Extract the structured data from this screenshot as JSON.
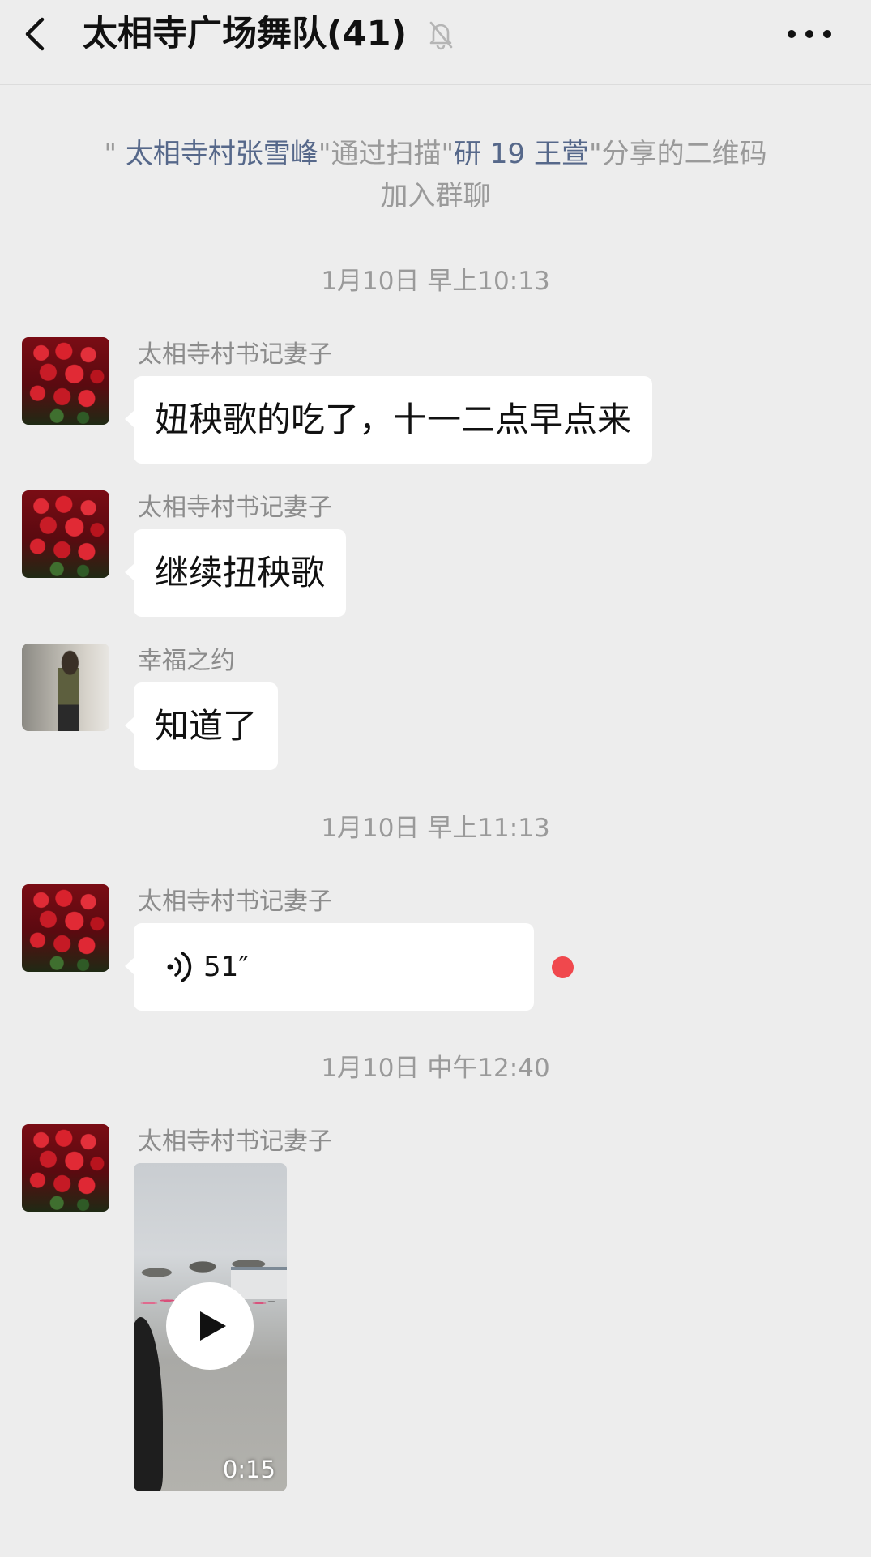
{
  "header": {
    "title": "太相寺广场舞队(41)",
    "back_icon": "chevron-left-icon",
    "mute_icon": "bell-off-icon",
    "more_icon": "more-horizontal-icon"
  },
  "system_notice": {
    "quote_open": "\"",
    "joiner": "太相寺村张雪峰",
    "text1": "\"通过扫描\"",
    "sharer": "研 19 王萱",
    "text2": "\"分享的二维码",
    "line2": "加入群聊",
    "link_color": "#56688a"
  },
  "timestamps": [
    "1月10日 早上10:13",
    "1月10日 早上11:13",
    "1月10日 中午12:40"
  ],
  "messages": [
    {
      "sender": "太相寺村书记妻子",
      "type": "text",
      "text": "妞秧歌的吃了，十一二点早点来",
      "avatar": "roses"
    },
    {
      "sender": "太相寺村书记妻子",
      "type": "text",
      "text": "继续扭秧歌",
      "avatar": "roses"
    },
    {
      "sender": "幸福之约",
      "type": "text",
      "text": "知道了",
      "avatar": "person"
    },
    {
      "sender": "太相寺村书记妻子",
      "type": "voice",
      "duration": "51″",
      "unread": true,
      "avatar": "roses"
    },
    {
      "sender": "太相寺村书记妻子",
      "type": "video",
      "duration": "0:15",
      "avatar": "roses"
    }
  ],
  "colors": {
    "background": "#ededed",
    "bubble": "#ffffff",
    "unread_dot": "#f0484d",
    "meta_text": "#9a9a9a"
  }
}
